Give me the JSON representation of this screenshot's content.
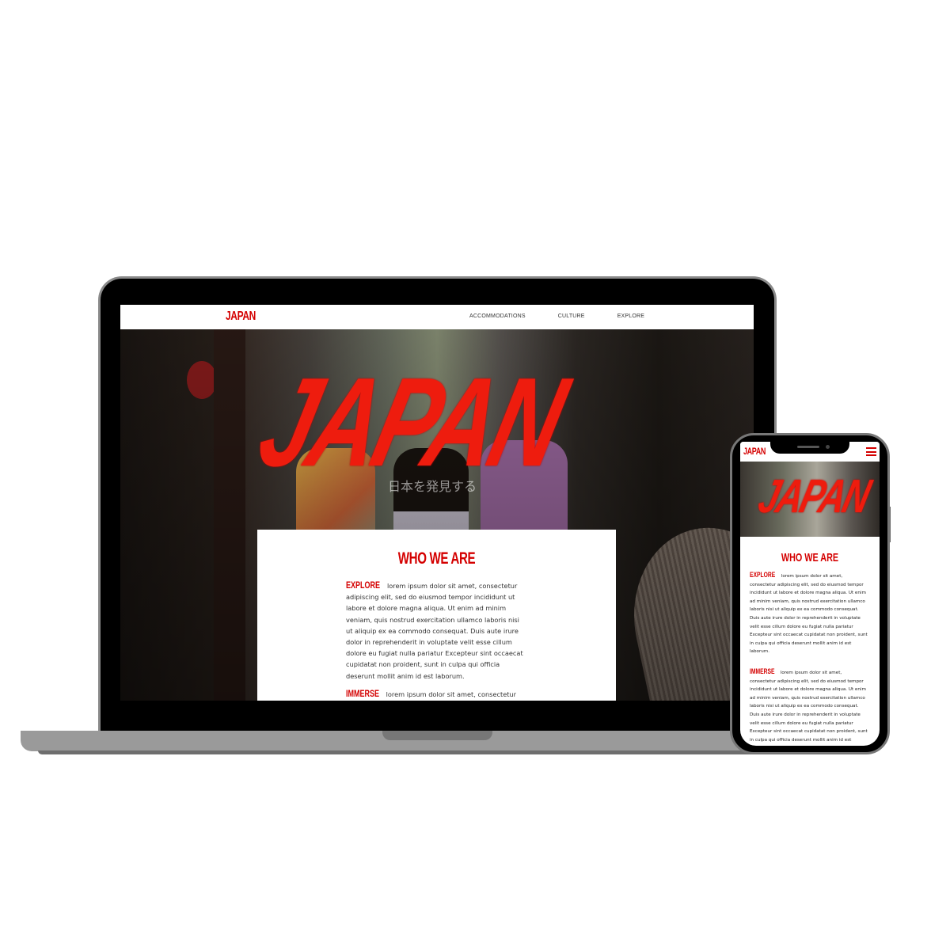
{
  "site": {
    "logo": "JAPAN",
    "nav": [
      "ACCOMMODATIONS",
      "CULTURE",
      "EXPLORE"
    ],
    "hero_title": "JAPAN",
    "hero_subtitle": "日本を発見する",
    "section_title": "WHO WE ARE",
    "sections": [
      {
        "keyword": "EXPLORE",
        "text": "lorem ipsum dolor sit amet, consectetur adipiscing elit, sed do eiusmod tempor incididunt ut labore et dolore magna aliqua. Ut enim ad minim veniam, quis nostrud exercitation ullamco laboris nisi ut aliquip ex ea commodo consequat. Duis aute irure dolor in reprehenderit in voluptate velit esse cillum dolore eu fugiat nulla pariatur Excepteur sint occaecat cupidatat non proident, sunt in culpa qui officia deserunt mollit anim id est laborum."
      },
      {
        "keyword": "IMMERSE",
        "text": "lorem ipsum dolor sit amet, consectetur adipiscing elit, sed do eiusmod tempor incididunt ut labore et dolore magna aliqua. Ut enim ad minim veniam, quis nostrud exercitation ullamco laboris nisi ut aliquip ex ea commodo consequat. Duis aute irure dolor in reprehenderit in voluptate velit esse cillum dolore eu fugiat nulla pariatur Excepteur sint occaecat cupidatat non proident, sunt in culpa qui officia deserunt mollit anim id est laborum."
      }
    ]
  },
  "colors": {
    "brand_red": "#d40000",
    "hero_red": "#ee1c0e"
  }
}
